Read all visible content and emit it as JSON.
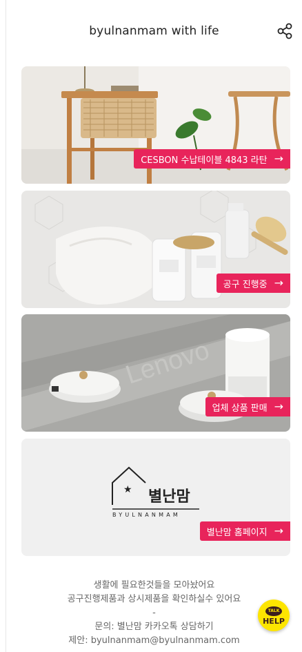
{
  "header": {
    "title": "byulnanmam with life",
    "share_icon": "share-icon"
  },
  "cards": [
    {
      "label": "CESBON 수납테이블 4843 라탄",
      "arrow": "→",
      "image": "rattan-side-table-photo"
    },
    {
      "label": "공구 진행중",
      "arrow": "→",
      "image": "cleaning-products-photo"
    },
    {
      "label": "업체 상품 판매",
      "arrow": "→",
      "image": "robot-vacuum-photo"
    },
    {
      "label": "별난맘 홈페이지",
      "arrow": "→",
      "image": "byulnanmam-logo"
    }
  ],
  "logo": {
    "korean": "별난맘",
    "english": "BYULNANMAM"
  },
  "footer": {
    "line1": "생활에 필요한것들을 모아놨어요",
    "line2": "공구진행제품과 상시제품을 확인하실수 있어요",
    "divider": "-",
    "line3": "문의: 별난맘 카카오톡 상담하기",
    "line4": "제안: byulnanmam@byulnanmam.com"
  },
  "kakao": {
    "talk": "TALK",
    "help": "HELP"
  },
  "colors": {
    "accent": "#e8245b",
    "kakao_yellow": "#fde500"
  }
}
